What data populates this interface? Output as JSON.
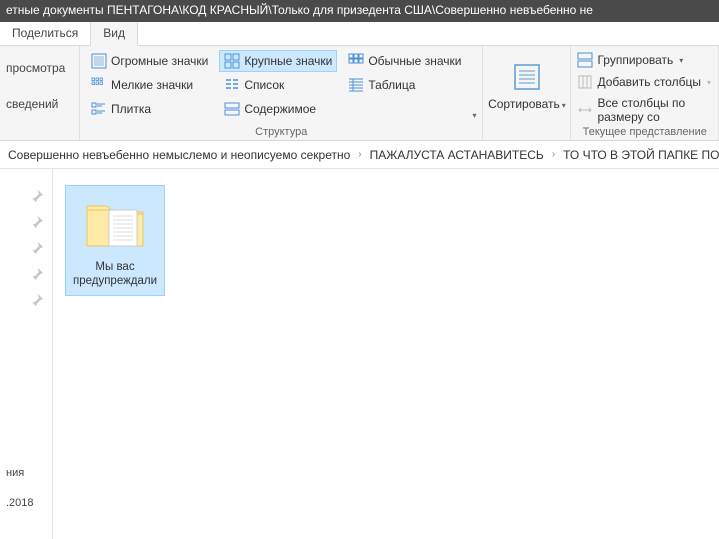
{
  "titlebar": "етные документы ПЕНТАГОНА\\КОД КРАСНЫЙ\\Только для призедента США\\Совершенно невъебенно не",
  "tabs": {
    "share": "Поделиться",
    "view": "Вид"
  },
  "ribbon": {
    "leftcol": {
      "preview": "просмотра",
      "details": "сведений"
    },
    "layout": {
      "label": "Структура",
      "huge": "Огромные значки",
      "large": "Крупные значки",
      "medium": "Обычные значки",
      "small": "Мелкие значки",
      "list": "Список",
      "table": "Таблица",
      "tiles": "Плитка",
      "content": "Содержимое"
    },
    "sort": "Сортировать",
    "view": {
      "label": "Текущее представление",
      "group": "Группировать",
      "addcols": "Добавить столбцы",
      "sizecols": "Все столбцы по размеру со"
    }
  },
  "breadcrumb": {
    "a": "Совершенно невъебенно немыслемо и неописуемо секретно",
    "b": "ПАЖАЛУСТА АСТАНАВИТЕСЬ",
    "c": "ТО ЧТО В ЭТОЙ ПАПКЕ ПОВ"
  },
  "folder": {
    "name": "Мы вас предупреждали"
  },
  "status": {
    "left": "ния",
    "date": ".2018"
  }
}
